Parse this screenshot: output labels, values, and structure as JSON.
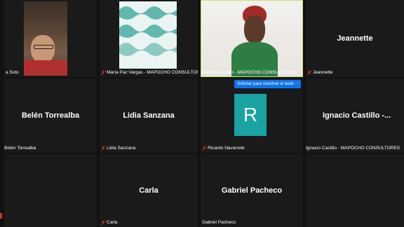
{
  "participants": [
    {
      "id": "soto",
      "label": "a Soto",
      "muted": false,
      "type": "video"
    },
    {
      "id": "maria",
      "label": "María Paz Vargas - MAPOCHO CONSULTORES",
      "muted": true,
      "type": "image"
    },
    {
      "id": "patricia",
      "label": "Patricia Castillo - MAPOCHO CONSULTORES",
      "muted": false,
      "type": "video",
      "active": true
    },
    {
      "id": "jeannette",
      "name": "Jeannette",
      "label": "Jeannette",
      "muted": true,
      "type": "name"
    },
    {
      "id": "belen",
      "name": "Belén Torrealba",
      "label": "Belén Torrealba",
      "muted": false,
      "type": "name"
    },
    {
      "id": "lidia",
      "name": "Lidia Sanzana",
      "label": "Lidia Sanzana",
      "muted": true,
      "type": "name"
    },
    {
      "id": "ricardo",
      "avatar_letter": "R",
      "label": "Ricardo Navarrete",
      "muted": true,
      "type": "avatar"
    },
    {
      "id": "ignacio",
      "name": "Ignacio Castillo -...",
      "label": "Ignacio Castillo - MAPOCHO CONSULTORES",
      "muted": false,
      "type": "name"
    },
    {
      "id": "carla",
      "name": "Carla",
      "label": "Carla",
      "muted": true,
      "type": "name"
    },
    {
      "id": "gabriel",
      "name": "Gabriel Pacheco",
      "label": "Gabriel Pacheco",
      "muted": false,
      "type": "name"
    }
  ],
  "unmute_request": {
    "label": "Solicitar para reactivar el audio",
    "more": "···"
  },
  "colors": {
    "tile_bg": "#1a1a1a",
    "active_border": "#c9e063",
    "accent": "#0e72ed",
    "avatar_bg": "#1aa3a3",
    "muted_icon": "#e02828"
  }
}
